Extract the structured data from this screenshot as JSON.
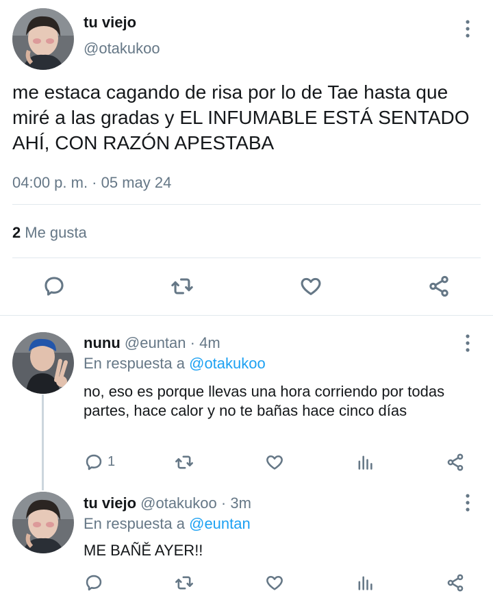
{
  "main_tweet": {
    "display_name": "tu viejo",
    "handle": "@otakukoo",
    "text": "me estaca cagando de risa por lo de Tae hasta que miré a las gradas y EL INFUMABLE ESTÁ SENTADO AHÍ, CON RAZÓN APESTABA",
    "timestamp": "04:00 p. m. · 05 may 24",
    "likes_count": "2",
    "likes_label": "Me gusta"
  },
  "replies": [
    {
      "display_name": "nunu",
      "handle": "@euntan",
      "time": "· 4m",
      "reply_prefix": "En respuesta a",
      "reply_to": "@otakukoo",
      "text": "no, eso es porque llevas una hora corriendo por todas partes, hace calor y no te bañas hace cinco días",
      "reply_count": "1"
    },
    {
      "display_name": "tu viejo",
      "handle": "@otakukoo",
      "time": "· 3m",
      "reply_prefix": "En respuesta a",
      "reply_to": "@euntan",
      "text": "ME BAÑĚ AYER!!"
    }
  ],
  "icons": [
    "reply-icon",
    "retweet-icon",
    "like-icon",
    "share-icon",
    "stats-icon",
    "more-icon"
  ],
  "colors": {
    "link": "#1da1f2",
    "muted": "#657786",
    "text": "#14171a",
    "divider": "#e1e8ed"
  }
}
